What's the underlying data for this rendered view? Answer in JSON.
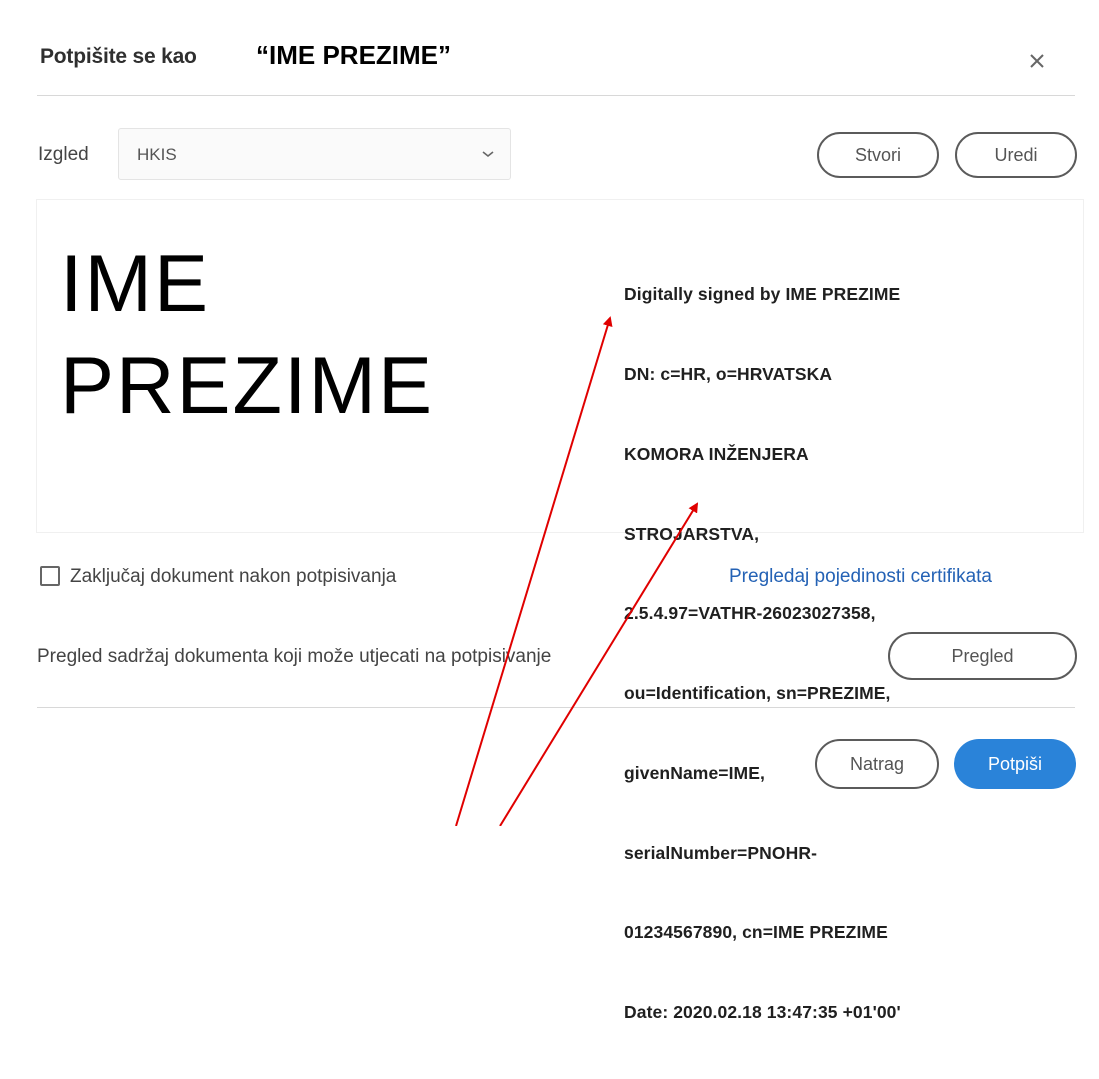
{
  "dialog": {
    "title_prefix": "Potpišite se kao",
    "title_name": "“IME PREZIME”",
    "close_icon": "close-icon"
  },
  "appearance": {
    "label": "Izgled",
    "selected": "HKIS",
    "create_label": "Stvori",
    "edit_label": "Uredi"
  },
  "signature": {
    "name_line1": "IME",
    "name_line2": "PREZIME",
    "details": [
      "Digitally signed by IME PREZIME",
      "DN: c=HR, o=HRVATSKA",
      "KOMORA INŽENJERA",
      "STROJARSTVA,",
      "2.5.4.97=VATHR-26023027358,",
      "ou=Identification, sn=PREZIME,",
      "givenName=IME,",
      "serialNumber=PNOHR-",
      "01234567890, cn=IME PREZIME",
      "Date: 2020.02.18 13:47:35 +01'00'"
    ]
  },
  "options": {
    "lock_label": "Zaključaj dokument nakon potpisivanja",
    "lock_checked": false,
    "cert_link": "Pregledaj pojedinosti certifikata",
    "preview_text": "Pregled sadržaj dokumenta koji može utjecati na potpisivanje",
    "preview_button": "Pregled"
  },
  "footer": {
    "back_label": "Natrag",
    "sign_label": "Potpiši",
    "sign_color": "#2a83d9"
  },
  "annotation": {
    "arrow_color": "#e00000"
  }
}
